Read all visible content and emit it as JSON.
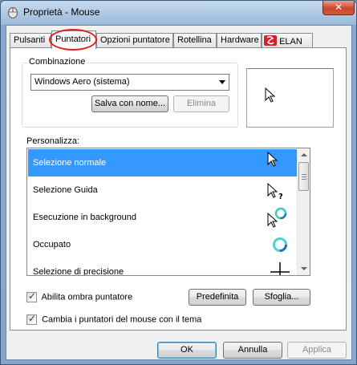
{
  "window": {
    "title": "Proprietà - Mouse",
    "close_label": "✕"
  },
  "tabs": [
    {
      "label": "Pulsanti"
    },
    {
      "label": "Puntatori"
    },
    {
      "label": "Opzioni puntatore"
    },
    {
      "label": "Rotellina"
    },
    {
      "label": "Hardware"
    },
    {
      "label": "ELAN"
    }
  ],
  "scheme": {
    "group_label": "Combinazione",
    "selected_value": "Windows Aero (sistema)",
    "save_as_label": "Salva con nome...",
    "delete_label": "Elimina"
  },
  "customize": {
    "label": "Personalizza:",
    "items": [
      {
        "label": "Selezione normale",
        "icon": "arrow-cursor-icon"
      },
      {
        "label": "Selezione Guida",
        "icon": "help-cursor-icon"
      },
      {
        "label": "Esecuzione in background",
        "icon": "working-in-background-cursor-icon"
      },
      {
        "label": "Occupato",
        "icon": "busy-cursor-icon"
      },
      {
        "label": "Selezione di precisione",
        "icon": "crosshair-cursor-icon"
      }
    ],
    "selected_index": 0
  },
  "options": {
    "shadow_label": "Abilita ombra puntatore",
    "shadow_checked": true,
    "default_label": "Predefinita",
    "browse_label": "Sfoglia...",
    "themes_label": "Cambia i puntatori del mouse con il tema",
    "themes_checked": true
  },
  "footer": {
    "ok_label": "OK",
    "cancel_label": "Annulla",
    "apply_label": "Applica"
  },
  "colors": {
    "selection": "#3399ff",
    "highlight_circle": "#e0201a",
    "close_button": "#c9462c"
  }
}
